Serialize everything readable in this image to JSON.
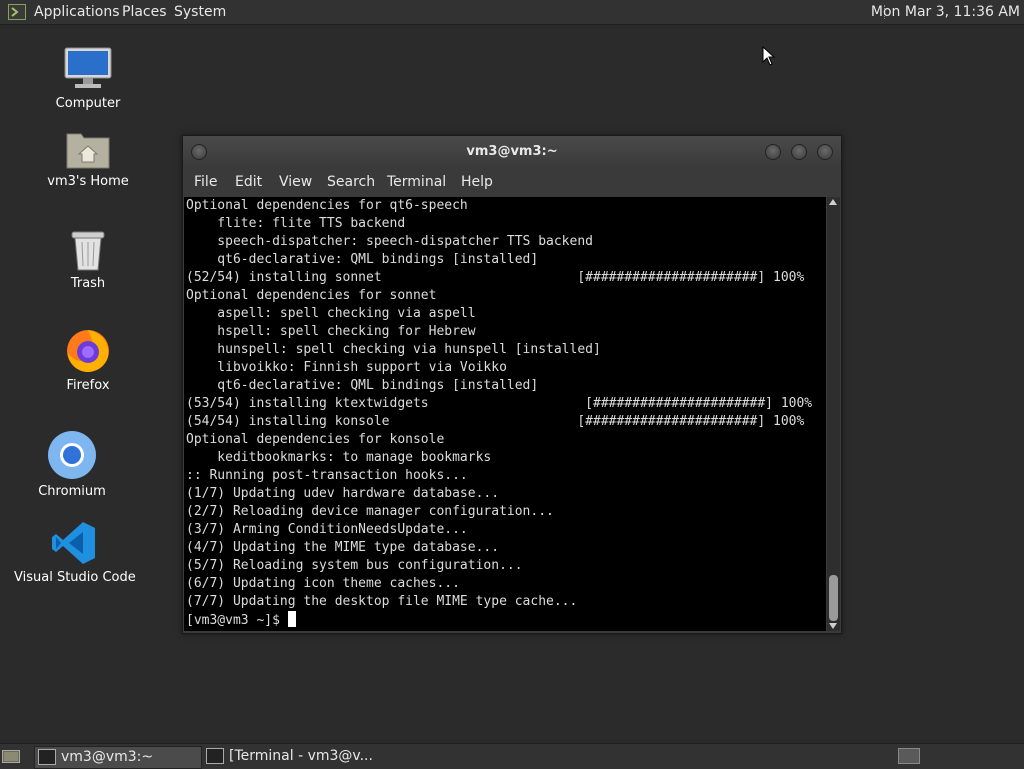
{
  "top_panel": {
    "menus": [
      "Applications",
      "Places",
      "System"
    ],
    "clock": "Mon Mar  3, 11:36 AM"
  },
  "desktop_icons": [
    {
      "label": "Computer",
      "icon": "computer-icon"
    },
    {
      "label": "vm3's Home",
      "icon": "home-folder-icon"
    },
    {
      "label": "Trash",
      "icon": "trash-icon"
    },
    {
      "label": "Firefox",
      "icon": "firefox-icon"
    },
    {
      "label": "Chromium",
      "icon": "chromium-icon"
    },
    {
      "label": "Visual Studio Code",
      "icon": "vscode-icon"
    }
  ],
  "terminal_window": {
    "title": "vm3@vm3:~",
    "menu": [
      "File",
      "Edit",
      "View",
      "Search",
      "Terminal",
      "Help"
    ],
    "lines": [
      "Optional dependencies for qt6-speech",
      "    flite: flite TTS backend",
      "    speech-dispatcher: speech-dispatcher TTS backend",
      "    qt6-declarative: QML bindings [installed]",
      "(52/54) installing sonnet                         [######################] 100%",
      "Optional dependencies for sonnet",
      "    aspell: spell checking via aspell",
      "    hspell: spell checking for Hebrew",
      "    hunspell: spell checking via hunspell [installed]",
      "    libvoikko: Finnish support via Voikko",
      "    qt6-declarative: QML bindings [installed]",
      "(53/54) installing ktextwidgets                    [######################] 100%",
      "(54/54) installing konsole                        [######################] 100%",
      "Optional dependencies for konsole",
      "    keditbookmarks: to manage bookmarks",
      ":: Running post-transaction hooks...",
      "(1/7) Updating udev hardware database...",
      "(2/7) Reloading device manager configuration...",
      "(3/7) Arming ConditionNeedsUpdate...",
      "(4/7) Updating the MIME type database...",
      "(5/7) Reloading system bus configuration...",
      "(6/7) Updating icon theme caches...",
      "(7/7) Updating the desktop file MIME type cache..."
    ],
    "prompt": "[vm3@vm3 ~]$ "
  },
  "taskbar": {
    "tasks": [
      {
        "label": "vm3@vm3:~",
        "active": true
      },
      {
        "label": "[Terminal - vm3@v...",
        "active": false
      }
    ]
  }
}
